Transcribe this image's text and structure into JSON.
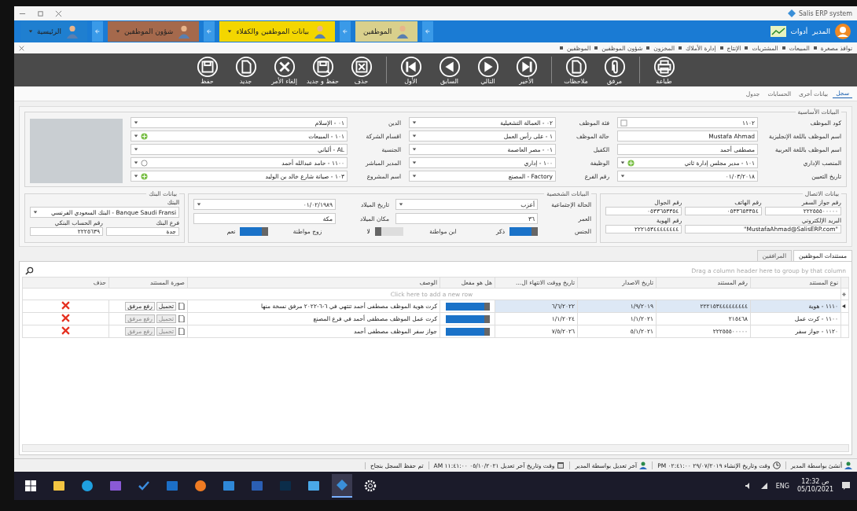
{
  "window": {
    "title": "Salis ERP system"
  },
  "topbar": {
    "user": "المدير",
    "tools": "أدوات",
    "modules": [
      {
        "label": "الموظفين",
        "color": "#d9d08c",
        "caret": false
      },
      {
        "label": "بيانات الموظفين والكفلاء",
        "color": "#f3d600",
        "caret": true
      },
      {
        "label": "شؤون الموظفين",
        "color": "#a5694c",
        "caret": true
      },
      {
        "label": "الرئيسية",
        "color": "#1f7fd0",
        "caret": true
      }
    ]
  },
  "breadcrumbs": [
    "نوافذ مصغرة",
    "المبيعات",
    "المشتريات",
    "الإنتاج",
    "إدارة الأملاك",
    "المخزون",
    "شؤون الموظفين",
    "الموظفين"
  ],
  "toolbar": [
    [
      {
        "kind": "print",
        "label": "طباعة"
      }
    ],
    [
      {
        "kind": "attach",
        "label": "مرفق"
      },
      {
        "kind": "notes",
        "label": "ملاحظات"
      }
    ],
    [
      {
        "kind": "last",
        "label": "الأخير"
      },
      {
        "kind": "next",
        "label": "التالي"
      },
      {
        "kind": "prev",
        "label": "السابق"
      },
      {
        "kind": "first",
        "label": "الأول"
      }
    ],
    [
      {
        "kind": "delete",
        "label": "حذف"
      },
      {
        "kind": "save-new",
        "label": "حفظ و جديد"
      },
      {
        "kind": "cancel",
        "label": "إلغاء الأمر"
      },
      {
        "kind": "new",
        "label": "جديد"
      },
      {
        "kind": "save",
        "label": "حفظ"
      }
    ]
  ],
  "record_tabs": [
    {
      "label": "سجل",
      "selected": true
    },
    {
      "label": "بيانات أخرى",
      "selected": false
    },
    {
      "label": "الحسابات",
      "selected": false
    },
    {
      "label": "جدول",
      "selected": false
    }
  ],
  "basic": {
    "title": "البيانات الأساسية",
    "columns": [
      [
        {
          "label": "كود الموظف",
          "value": "١١٠٢",
          "kind": "lookup"
        },
        {
          "label": "اسم الموظف باللغة الإنجليزية",
          "value": "Mustafa Ahmad",
          "kind": "text"
        },
        {
          "label": "اسم الموظف باللغة العربية",
          "value": "مصطفى أحمد",
          "kind": "text"
        },
        {
          "label": "المنصب الإداري",
          "value": "١٠١ - مدير مجلس إدارة ثاني",
          "kind": "add"
        },
        {
          "label": "تاريخ التعيين",
          "value": "٠١/٠٣/٢٠١٨",
          "kind": "dropdown"
        }
      ],
      [
        {
          "label": "فئة الموظف",
          "value": "٠٢ - العمالة التشغيلية",
          "kind": "dropdown"
        },
        {
          "label": "حالة الموظف",
          "value": "١ - على رأس العمل",
          "kind": "dropdown"
        },
        {
          "label": "الكفيل",
          "value": "٠١ - مصر العاصمة",
          "kind": "dropdown"
        },
        {
          "label": "الوظيفة",
          "value": "١٠٠ - إداري",
          "kind": "dropdown"
        },
        {
          "label": "رقم الفرع",
          "value": "Factory - المصنع",
          "kind": "dropdown"
        }
      ],
      [
        {
          "label": "الدين",
          "value": "٠١ - الإسلام",
          "kind": "dropdown"
        },
        {
          "label": "اقسام الشركة",
          "value": "١٠١ - المبيعات",
          "kind": "add"
        },
        {
          "label": "الجنسية",
          "value": "AL - ألباني",
          "kind": "dropdown"
        },
        {
          "label": "المدير المباشر",
          "value": "١١٠٠ - حامد عبدالله أحمد",
          "kind": "clear"
        },
        {
          "label": "اسم المشروع",
          "value": "١٠٣ - صيانة شارع خالد بن الوليد",
          "kind": "add"
        }
      ]
    ]
  },
  "contact": {
    "title": "بيانات الاتصال",
    "fields": [
      {
        "label": "رقم جواز السفر",
        "value": "٢٢٢٥٥٥٠٠٠٠٠",
        "kind": "text"
      },
      {
        "label": "رقم الهاتف",
        "value": "٠٥٣٣٦٥٣٣٥٤",
        "kind": "text"
      },
      {
        "label": "رقم الجوال",
        "value": "٠٥٣٣٦٥٣٣٥٤",
        "kind": "text"
      },
      {
        "label": "البريد الإلكتروني",
        "value": "\"MustafaAhmad@SalisERP.com\"",
        "kind": "wide"
      },
      {
        "label": "رقم الهوية",
        "value": "٢٢٢١٥٣٤٤٤٤٤٤٤٤",
        "kind": "text"
      }
    ]
  },
  "personal": {
    "title": "البيانات الشخصية",
    "rows": [
      [
        {
          "label": "الحالة الإجتماعية",
          "value": "أعزب",
          "kind": "dropdown"
        },
        {
          "label": "تاريخ الميلاد",
          "value": "٠١/٠٢/١٩٨٩",
          "kind": "dropdown"
        }
      ],
      [
        {
          "label": "العمر",
          "value": "٣٦",
          "kind": "text"
        },
        {
          "label": "مكان الميلاد",
          "value": "مكة",
          "kind": "text"
        }
      ],
      [
        {
          "label": "الجنس",
          "value": "ذكر",
          "kind": "toggle",
          "on": true
        },
        {
          "label": "ابن مواطنة",
          "value": "لا",
          "kind": "toggle",
          "on": false
        },
        {
          "label": "زوج مواطنة",
          "value": "نعم",
          "kind": "toggle",
          "on": true
        }
      ]
    ]
  },
  "bank": {
    "title": "بيانات البنك",
    "bank_label": "البنك",
    "bank": "Banque Saudi Fransi - البنك السعودي الفرنسي",
    "fields": [
      {
        "label": "فرع البنك",
        "value": "جدة"
      },
      {
        "label": "رقم الحساب البنكي",
        "value": "٢٢٢٥٦٣٩"
      }
    ]
  },
  "documents": {
    "tabs": [
      {
        "label": "مستندات الموظفين",
        "selected": true
      },
      {
        "label": "المرافقين",
        "selected": false
      }
    ],
    "group_hint": "Drag a column header here to group by that column",
    "columns": [
      "نوع المستند",
      "رقم المستند",
      "تاريخ الاصدار",
      "تاريخ ووقت الانتهاء ال...",
      "هل هو مفعل",
      "الوصف",
      "صورة المستند",
      "حذف"
    ],
    "new_row_hint": "Click here to add a new row",
    "rows": [
      {
        "type": "١١١٠ - هوية",
        "number": "٢٢٢١٥٣٤٤٤٤٤٤٤٤٤",
        "issued": "١/٩/٢٠١٩",
        "expires": "٦/٦/٢٠٢٢",
        "active": true,
        "description": "كرت هوية الموظف مصطفى أحمد تنتهي في ٦-٦-٢٠٢٢ مرفق نسخة منها",
        "selected": true,
        "disabled": false,
        "download": "تحميل",
        "upload": "رفع مرفق"
      },
      {
        "type": "١١٠٠ - كرت عمل",
        "number": "٢١٥٤٦٨",
        "issued": "١/١/٢٠٢١",
        "expires": "١/١/٢٠٢٤",
        "active": true,
        "description": "كرت عمل الموظف مصطفى أحمد في فرع المصنع",
        "selected": false,
        "disabled": true,
        "download": "تحميل",
        "upload": "رفع مرفق"
      },
      {
        "type": "١١٢٠ - جواز سفر",
        "number": "٢٢٢٥٥٥٠٠٠٠٠",
        "issued": "٥/١/٢٠٢١",
        "expires": "٧/٥/٢٠٢٦",
        "active": true,
        "description": "جواز سفر الموظف مصطفى أحمد",
        "selected": false,
        "disabled": true,
        "download": "تحميل",
        "upload": "رفع مرفق"
      }
    ]
  },
  "status_bar": [
    {
      "kind": "user",
      "text": "أنشئ بواسطة المدير"
    },
    {
      "kind": "clock",
      "text": "وقت وتاريخ الإنشاء ٢٩/٠٧/٢٠١٩ ٠٢:٤١:٠٠ PM"
    },
    {
      "kind": "user",
      "text": "آخر تعديل بواسطة المدير"
    },
    {
      "kind": "calendar",
      "text": "وقت وتاريخ آخر تعديل ٠٥/١٠/٢٠٢١ ١١:٤١:٠٠ AM"
    },
    {
      "kind": "message",
      "text": "تم حفظ السجل بنجاح"
    }
  ],
  "taskbar": {
    "apps": [
      {
        "kind": "windows",
        "selected": false
      },
      {
        "kind": "folder",
        "selected": false
      },
      {
        "kind": "edge",
        "selected": false
      },
      {
        "kind": "studio",
        "selected": false
      },
      {
        "kind": "check",
        "selected": false
      },
      {
        "kind": "mail",
        "selected": false
      },
      {
        "kind": "firefox",
        "selected": false
      },
      {
        "kind": "app",
        "selected": false
      },
      {
        "kind": "word",
        "selected": false
      },
      {
        "kind": "photoshop",
        "selected": false
      },
      {
        "kind": "notepad",
        "selected": false
      },
      {
        "kind": "erp",
        "selected": true
      },
      {
        "kind": "gear",
        "selected": false
      }
    ],
    "lang": "ENG",
    "time": "12:32 ص",
    "date": "05/10/2021"
  }
}
